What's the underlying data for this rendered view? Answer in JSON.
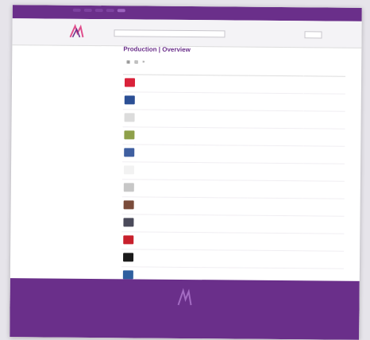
{
  "topbar": {
    "tabs": [
      "",
      "",
      "",
      "",
      ""
    ],
    "active_tab": 4,
    "link": ""
  },
  "header": {
    "search_placeholder": "",
    "links": [
      "",
      "",
      ""
    ],
    "button_label": ""
  },
  "sidebar": {
    "nav": [
      "",
      "",
      ""
    ],
    "section_title": "",
    "group1_title": "",
    "group1_items": [
      "",
      "",
      "",
      "",
      ""
    ],
    "group2_title": "",
    "group2_items": [
      "",
      "",
      "",
      "",
      "",
      "",
      "",
      "",
      ""
    ],
    "group3_title": "",
    "group3_items": [
      "",
      ""
    ]
  },
  "main": {
    "title": "Production | Overview",
    "sort_info": "",
    "view_icons": "▦ ▤ ≡",
    "columns": [
      "",
      "",
      "",
      "",
      ""
    ],
    "rows": [
      {
        "thumb_color": "#d9223a",
        "name": "",
        "type": "",
        "financier": "",
        "date": ""
      },
      {
        "thumb_color": "#2b4f95",
        "name": "",
        "type": "",
        "financier": "",
        "date": ""
      },
      {
        "thumb_color": "#dcdcdc",
        "name": "",
        "type": "",
        "financier": "",
        "date": ""
      },
      {
        "thumb_color": "#8ea04a",
        "name": "",
        "type": "",
        "financier": "",
        "date": ""
      },
      {
        "thumb_color": "#3f5fa0",
        "name": "",
        "type": "",
        "financier": "",
        "date": ""
      },
      {
        "thumb_color": "#f2f2f2",
        "name": "",
        "type": "",
        "financier": "",
        "date": ""
      },
      {
        "thumb_color": "#c7c7c7",
        "name": "",
        "type": "",
        "financier": "",
        "date": ""
      },
      {
        "thumb_color": "#7a4b3a",
        "name": "",
        "type": "",
        "financier": "",
        "date": ""
      },
      {
        "thumb_color": "#4a4a5a",
        "name": "",
        "type": "",
        "financier": "",
        "date": ""
      },
      {
        "thumb_color": "#c8202c",
        "name": "",
        "type": "",
        "financier": "",
        "date": ""
      },
      {
        "thumb_color": "#1a1a1a",
        "name": "",
        "type": "",
        "financier": "",
        "date": ""
      },
      {
        "thumb_color": "#2f5f9f",
        "name": "",
        "type": "",
        "financier": "",
        "date": ""
      }
    ]
  },
  "footer": {
    "line1": "",
    "links": [
      "",
      "",
      "",
      "",
      ""
    ],
    "line3": ""
  },
  "colors": {
    "brand": "#6a2f8a",
    "background": "#e6e4ea"
  }
}
